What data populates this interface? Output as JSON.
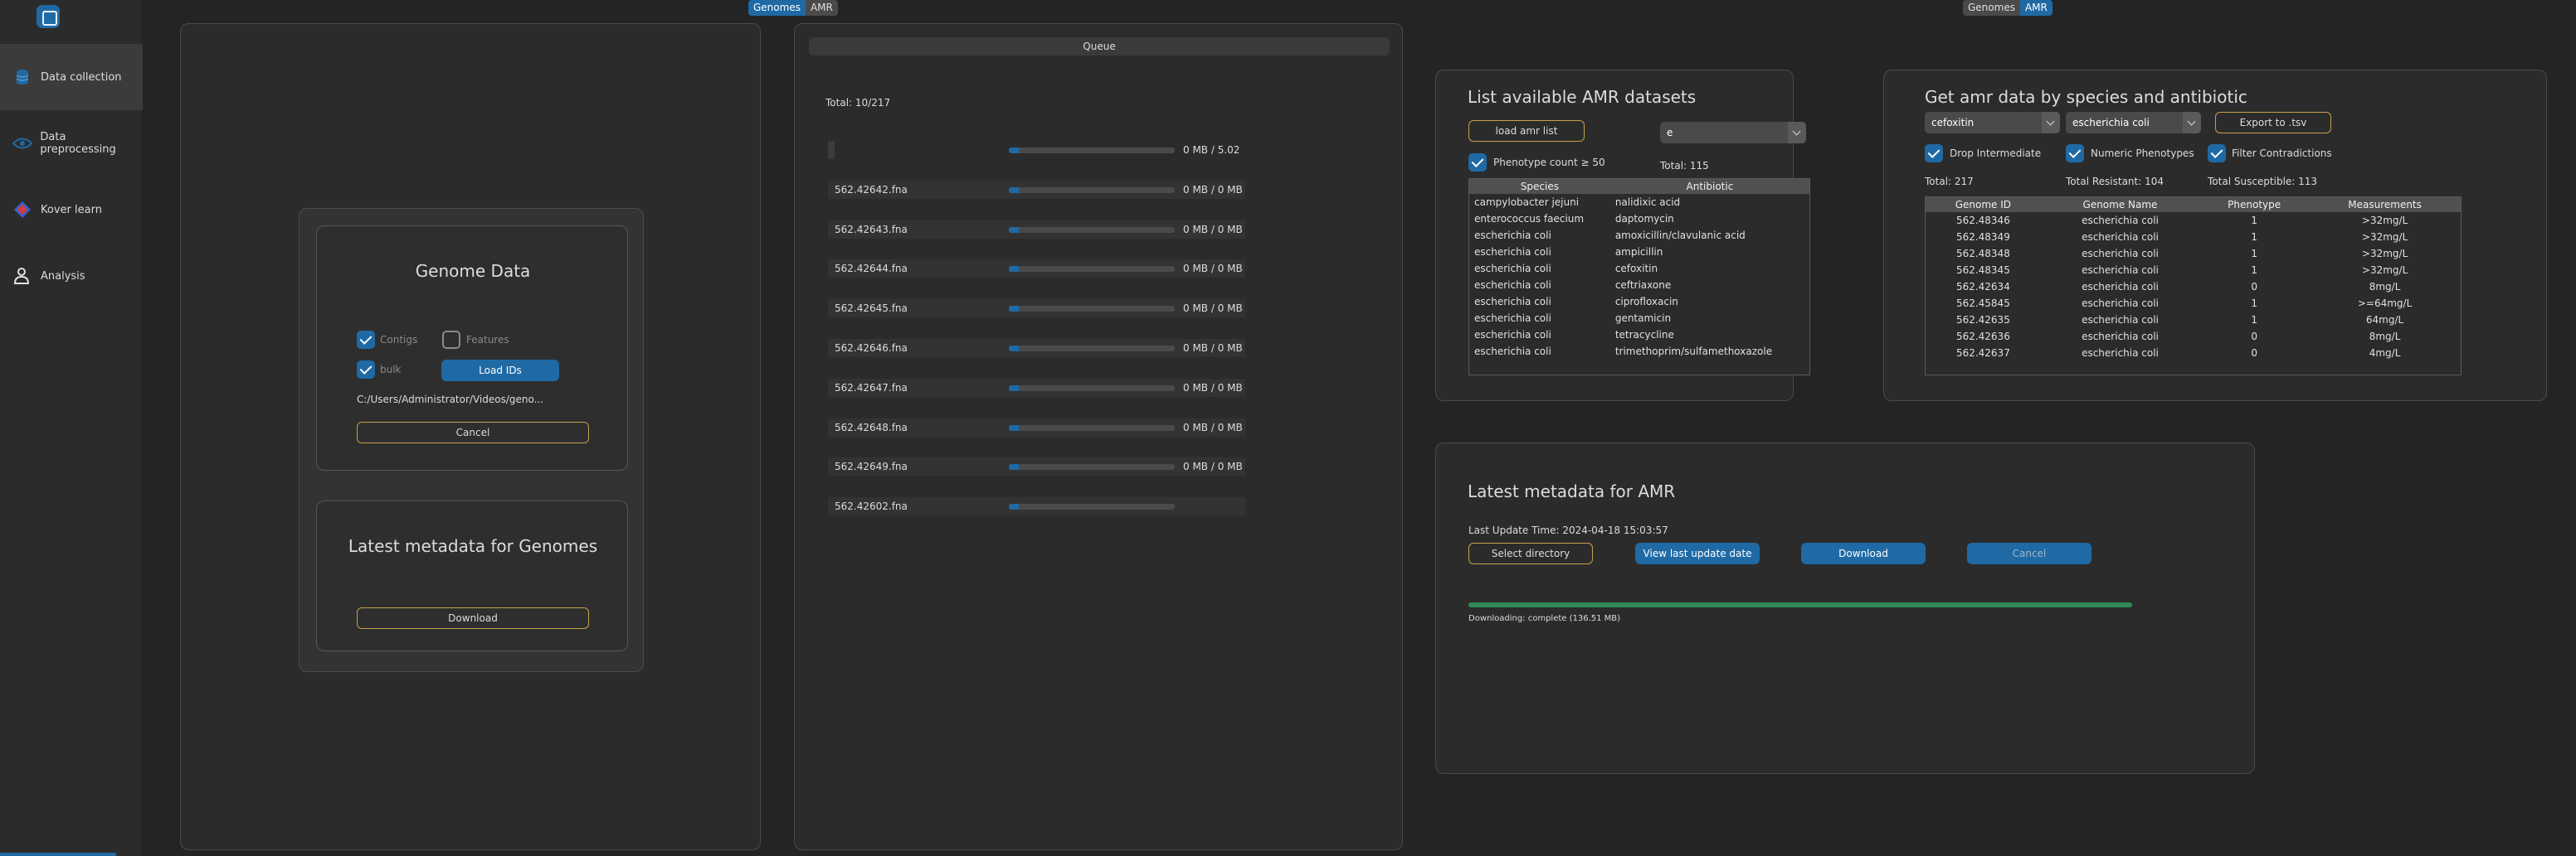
{
  "sidebar": {
    "items": [
      {
        "label": "Data collection",
        "icon": "database-icon"
      },
      {
        "label": "Data preprocessing",
        "icon": "eye-icon"
      },
      {
        "label": "Kover learn",
        "icon": "kover-icon"
      },
      {
        "label": "Analysis",
        "icon": "user-analysis-icon"
      }
    ]
  },
  "left_tabs": {
    "genomes": "Genomes",
    "amr": "AMR",
    "selected": "Genomes"
  },
  "right_tabs": {
    "genomes": "Genomes",
    "amr": "AMR",
    "selected": "AMR"
  },
  "genome_data": {
    "title": "Genome Data",
    "contigs_label": "Contigs",
    "contigs_checked": true,
    "features_label": "Features",
    "features_checked": false,
    "bulk_label": "bulk",
    "bulk_checked": true,
    "load_ids_label": "Load IDs",
    "path": "C:/Users/Administrator/Videos/geno...",
    "cancel_label": "Cancel"
  },
  "metadata_genomes": {
    "title": "Latest metadata for Genomes",
    "download_label": "Download"
  },
  "queue": {
    "header": "Queue",
    "total": "Total: 10/217",
    "items": [
      {
        "name": "",
        "size": "0 MB / 5.02",
        "progress": 0.06
      },
      {
        "name": "562.42642.fna",
        "size": "0 MB / 0 MB",
        "progress": 0.06
      },
      {
        "name": "562.42643.fna",
        "size": "0 MB / 0 MB",
        "progress": 0.06
      },
      {
        "name": "562.42644.fna",
        "size": "0 MB / 0 MB",
        "progress": 0.06
      },
      {
        "name": "562.42645.fna",
        "size": "0 MB / 0 MB",
        "progress": 0.06
      },
      {
        "name": "562.42646.fna",
        "size": "0 MB / 0 MB",
        "progress": 0.06
      },
      {
        "name": "562.42647.fna",
        "size": "0 MB / 0 MB",
        "progress": 0.06
      },
      {
        "name": "562.42648.fna",
        "size": "0 MB / 0 MB",
        "progress": 0.06
      },
      {
        "name": "562.42649.fna",
        "size": "0 MB / 0 MB",
        "progress": 0.06
      },
      {
        "name": "562.42602.fna",
        "size": "",
        "progress": 0.06
      }
    ]
  },
  "amr_list": {
    "title": "List available AMR datasets",
    "load_label": "load amr list",
    "filter_value": "e",
    "phenotype_label": "Phenotype count ≥ 50",
    "phenotype_checked": true,
    "total": "Total: 115",
    "columns": [
      "Species",
      "Antibiotic"
    ],
    "rows": [
      [
        "campylobacter jejuni",
        "nalidixic acid"
      ],
      [
        "enterococcus faecium",
        "daptomycin"
      ],
      [
        "escherichia coli",
        "amoxicillin/clavulanic acid"
      ],
      [
        "escherichia coli",
        "ampicillin"
      ],
      [
        "escherichia coli",
        "cefoxitin"
      ],
      [
        "escherichia coli",
        "ceftriaxone"
      ],
      [
        "escherichia coli",
        "ciprofloxacin"
      ],
      [
        "escherichia coli",
        "gentamicin"
      ],
      [
        "escherichia coli",
        "tetracycline"
      ],
      [
        "escherichia coli",
        "trimethoprim/sulfamethoxazole"
      ]
    ]
  },
  "amr_get": {
    "title": "Get amr data by species and antibiotic",
    "antibiotic_value": "cefoxitin",
    "species_value": "escherichia coli",
    "export_label": "Export to .tsv",
    "drop_label": "Drop Intermediate",
    "drop_checked": true,
    "numeric_label": "Numeric Phenotypes",
    "numeric_checked": true,
    "filter_label": "Filter Contradictions",
    "filter_checked": true,
    "total": "Total: 217",
    "resistant": "Total Resistant: 104",
    "susceptible": "Total Susceptible: 113",
    "columns": [
      "Genome ID",
      "Genome Name",
      "Phenotype",
      "Measurements"
    ],
    "rows": [
      [
        "562.48346",
        "escherichia coli",
        "1",
        ">32mg/L"
      ],
      [
        "562.48349",
        "escherichia coli",
        "1",
        ">32mg/L"
      ],
      [
        "562.48348",
        "escherichia coli",
        "1",
        ">32mg/L"
      ],
      [
        "562.48345",
        "escherichia coli",
        "1",
        ">32mg/L"
      ],
      [
        "562.42634",
        "escherichia coli",
        "0",
        "8mg/L"
      ],
      [
        "562.45845",
        "escherichia coli",
        "1",
        ">=64mg/L"
      ],
      [
        "562.42635",
        "escherichia coli",
        "1",
        "64mg/L"
      ],
      [
        "562.42636",
        "escherichia coli",
        "0",
        "8mg/L"
      ],
      [
        "562.42637",
        "escherichia coli",
        "0",
        "4mg/L"
      ]
    ]
  },
  "amr_metadata": {
    "title": "Latest metadata for AMR",
    "last_update": "Last Update Time: 2024-04-18 15:03:57",
    "select_dir_label": "Select directory",
    "view_last_label": "View last update date",
    "download_label": "Download",
    "cancel_label": "Cancel",
    "progress": 1.0,
    "status": "Downloading: complete (136.51 MB)"
  },
  "colors": {
    "accent": "#1f6aa5",
    "outline": "#c8a04a",
    "progress_done": "#2f8a55"
  }
}
